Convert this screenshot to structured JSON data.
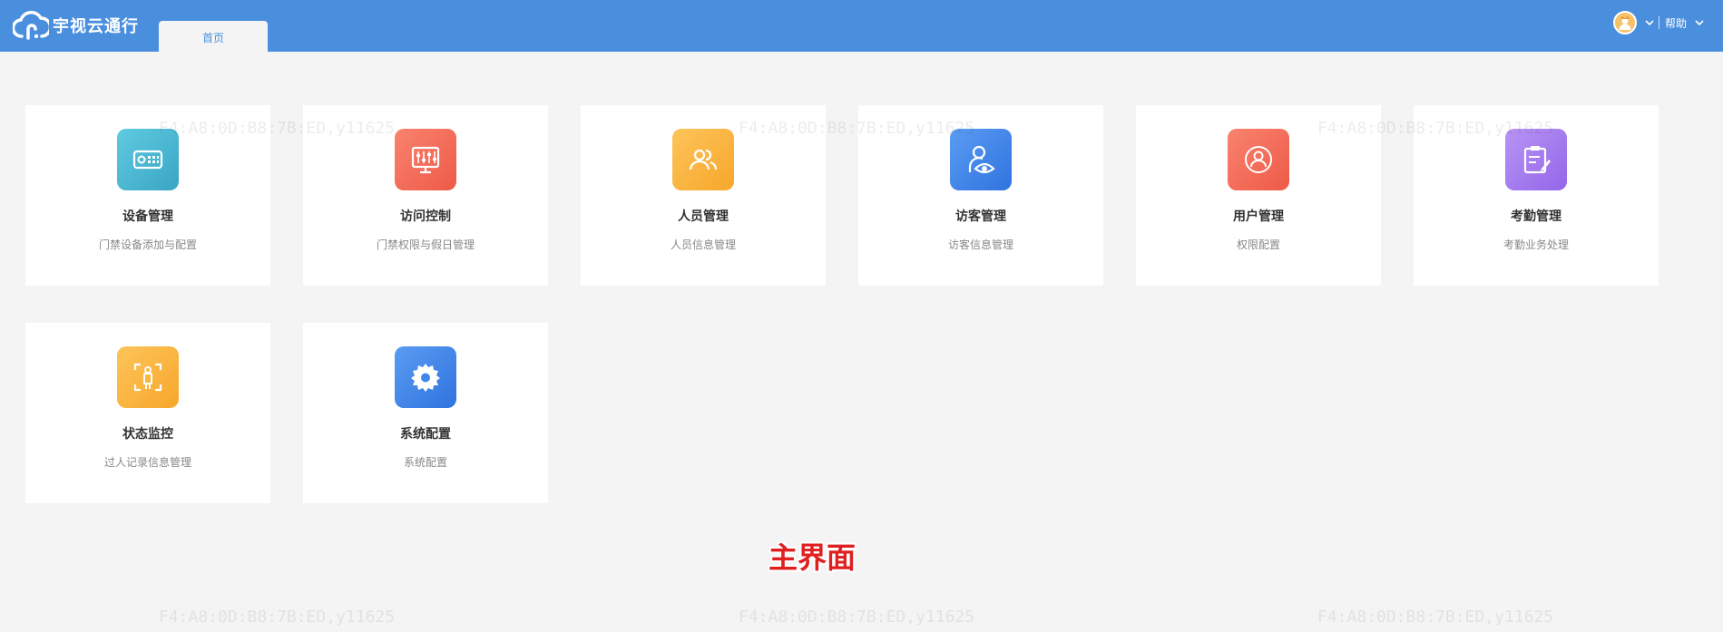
{
  "app": {
    "brand_name": "宇视云通行"
  },
  "tabs": [
    {
      "label": "首页",
      "active": true
    }
  ],
  "header": {
    "help_label": "帮助",
    "avatar_icon": "user-avatar-icon"
  },
  "modules": [
    {
      "title": "设备管理",
      "desc": "门禁设备添加与配置",
      "icon": "device-icon",
      "color": "#4bb8d1"
    },
    {
      "title": "访问控制",
      "desc": "门禁权限与假日管理",
      "icon": "access-control-icon",
      "color": "#f26b5a"
    },
    {
      "title": "人员管理",
      "desc": "人员信息管理",
      "icon": "people-icon",
      "color": "#f9b13e"
    },
    {
      "title": "访客管理",
      "desc": "访客信息管理",
      "icon": "visitor-icon",
      "color": "#3f86ea"
    },
    {
      "title": "用户管理",
      "desc": "权限配置",
      "icon": "user-icon",
      "color": "#f26b5a"
    },
    {
      "title": "考勤管理",
      "desc": "考勤业务处理",
      "icon": "attendance-icon",
      "color": "#a77ef0"
    },
    {
      "title": "状态监控",
      "desc": "过人记录信息管理",
      "icon": "status-monitor-icon",
      "color": "#f9b13e"
    },
    {
      "title": "系统配置",
      "desc": "系统配置",
      "icon": "settings-gear-icon",
      "color": "#3f86ea"
    }
  ],
  "watermark_text": "F4:A8:0D:B8:7B:ED,y11625",
  "overlay_caption": "主界面"
}
